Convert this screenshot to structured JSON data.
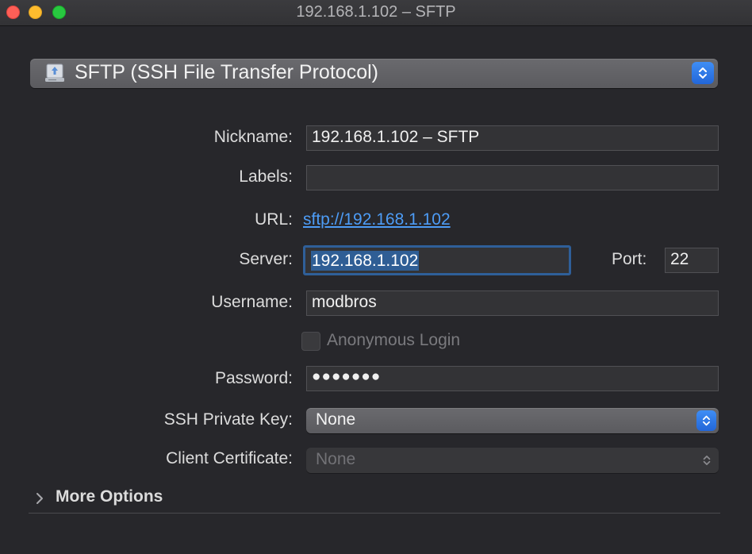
{
  "window": {
    "title": "192.168.1.102 – SFTP"
  },
  "protocol": {
    "selected": "SFTP (SSH File Transfer Protocol)",
    "icon": "sftp-drive-icon"
  },
  "form": {
    "nickname_label": "Nickname:",
    "nickname_value": "192.168.1.102 – SFTP",
    "labels_label": "Labels:",
    "labels_value": "",
    "url_label": "URL:",
    "url_value": "sftp://192.168.1.102",
    "server_label": "Server:",
    "server_value": "192.168.1.102",
    "port_label": "Port:",
    "port_value": "22",
    "username_label": "Username:",
    "username_value": "modbros",
    "anonymous_label": "Anonymous Login",
    "anonymous_checked": false,
    "password_label": "Password:",
    "password_value": "●●●●●●●",
    "ssh_key_label": "SSH Private Key:",
    "ssh_key_value": "None",
    "client_cert_label": "Client Certificate:",
    "client_cert_value": "None"
  },
  "footer": {
    "more_options_label": "More Options"
  },
  "colors": {
    "accent": "#3f8ef5",
    "link": "#4d9cf6",
    "selection": "#2f5e95",
    "focus_ring": "#2f5f99"
  }
}
